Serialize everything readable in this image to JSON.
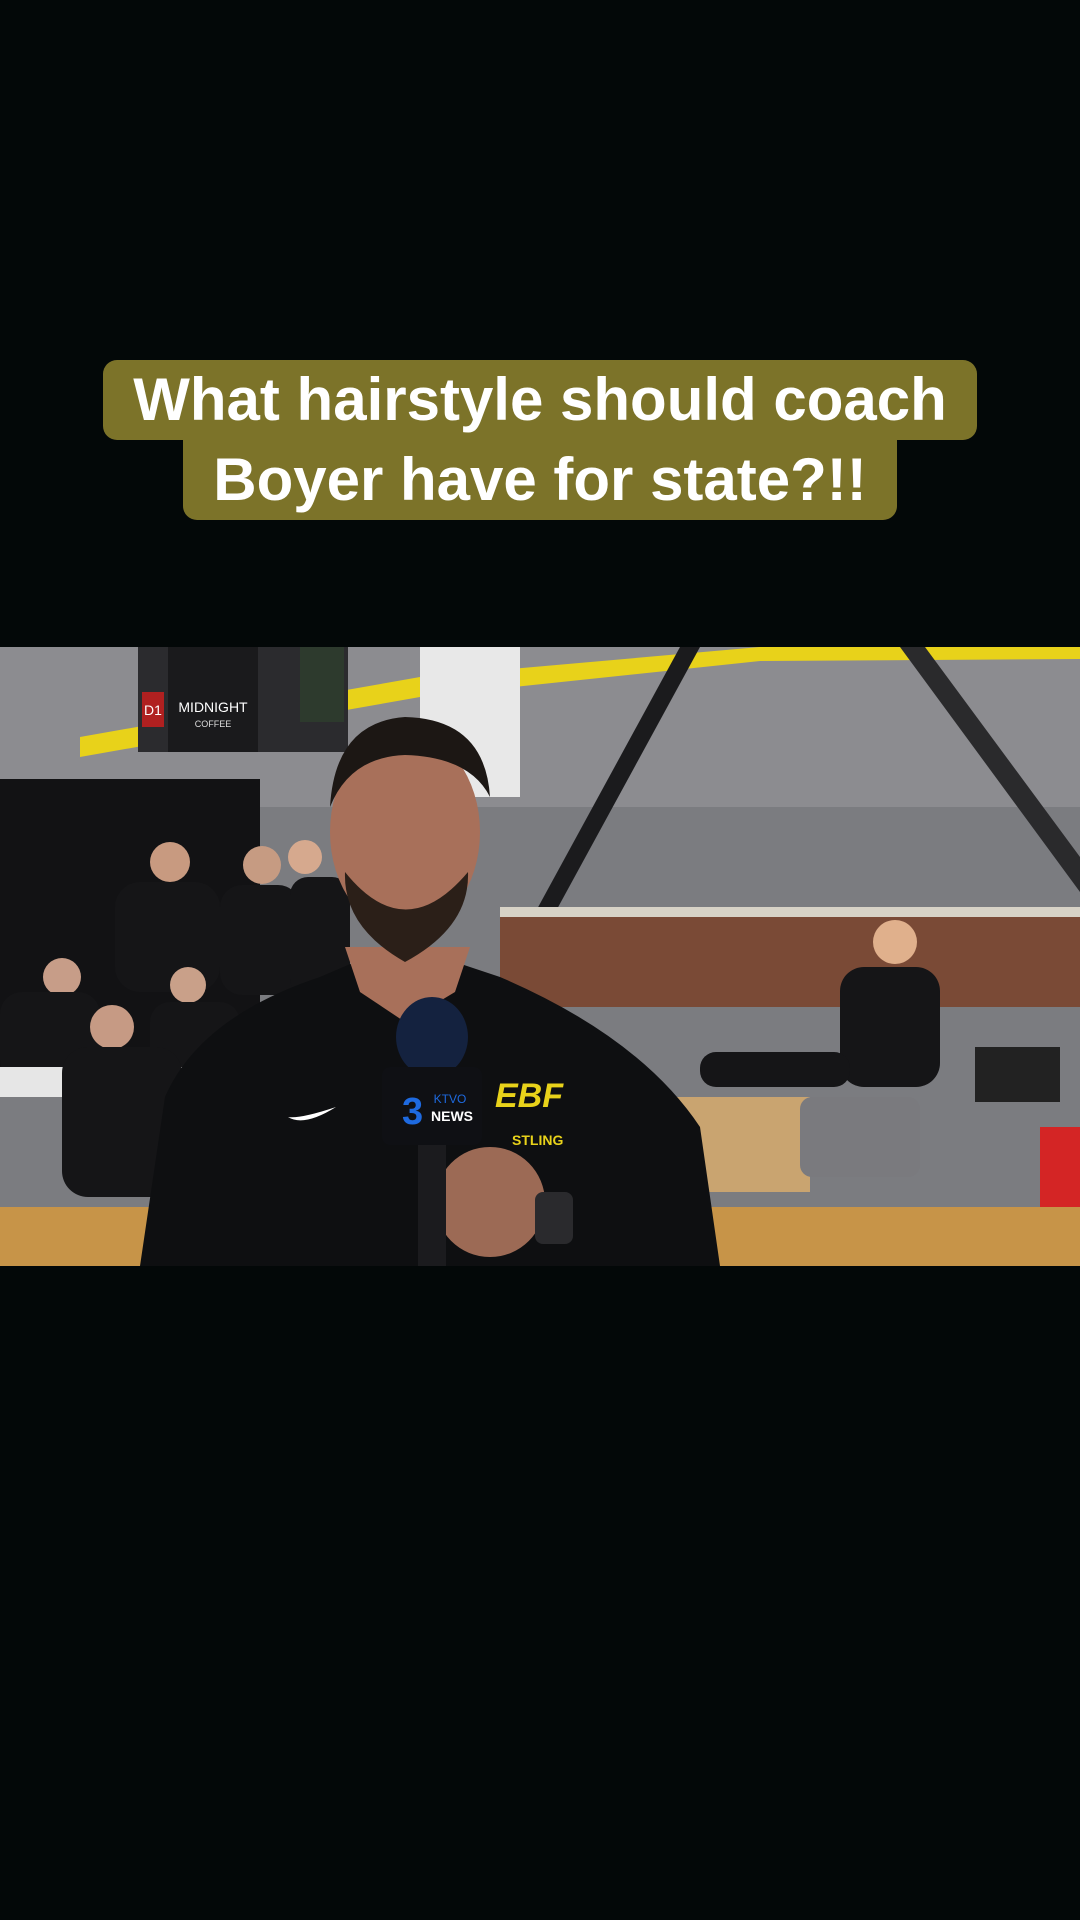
{
  "caption": {
    "line1": "What hairstyle should coach",
    "line2": "Boyer have for state?!!"
  },
  "video": {
    "scoreboard_text": "MIDNIGHT",
    "scoreboard_subtext": "COFFEE",
    "side_badge": "D1",
    "mic_flag_number": "3",
    "mic_flag_station": "KTVO",
    "mic_flag_label": "NEWS",
    "shirt_logo": "EBF",
    "shirt_text": "STLING"
  },
  "colors": {
    "background": "#030808",
    "caption_bg": "#7c7329",
    "caption_text": "#ffffff",
    "gym_yellow": "#e8d21a"
  }
}
